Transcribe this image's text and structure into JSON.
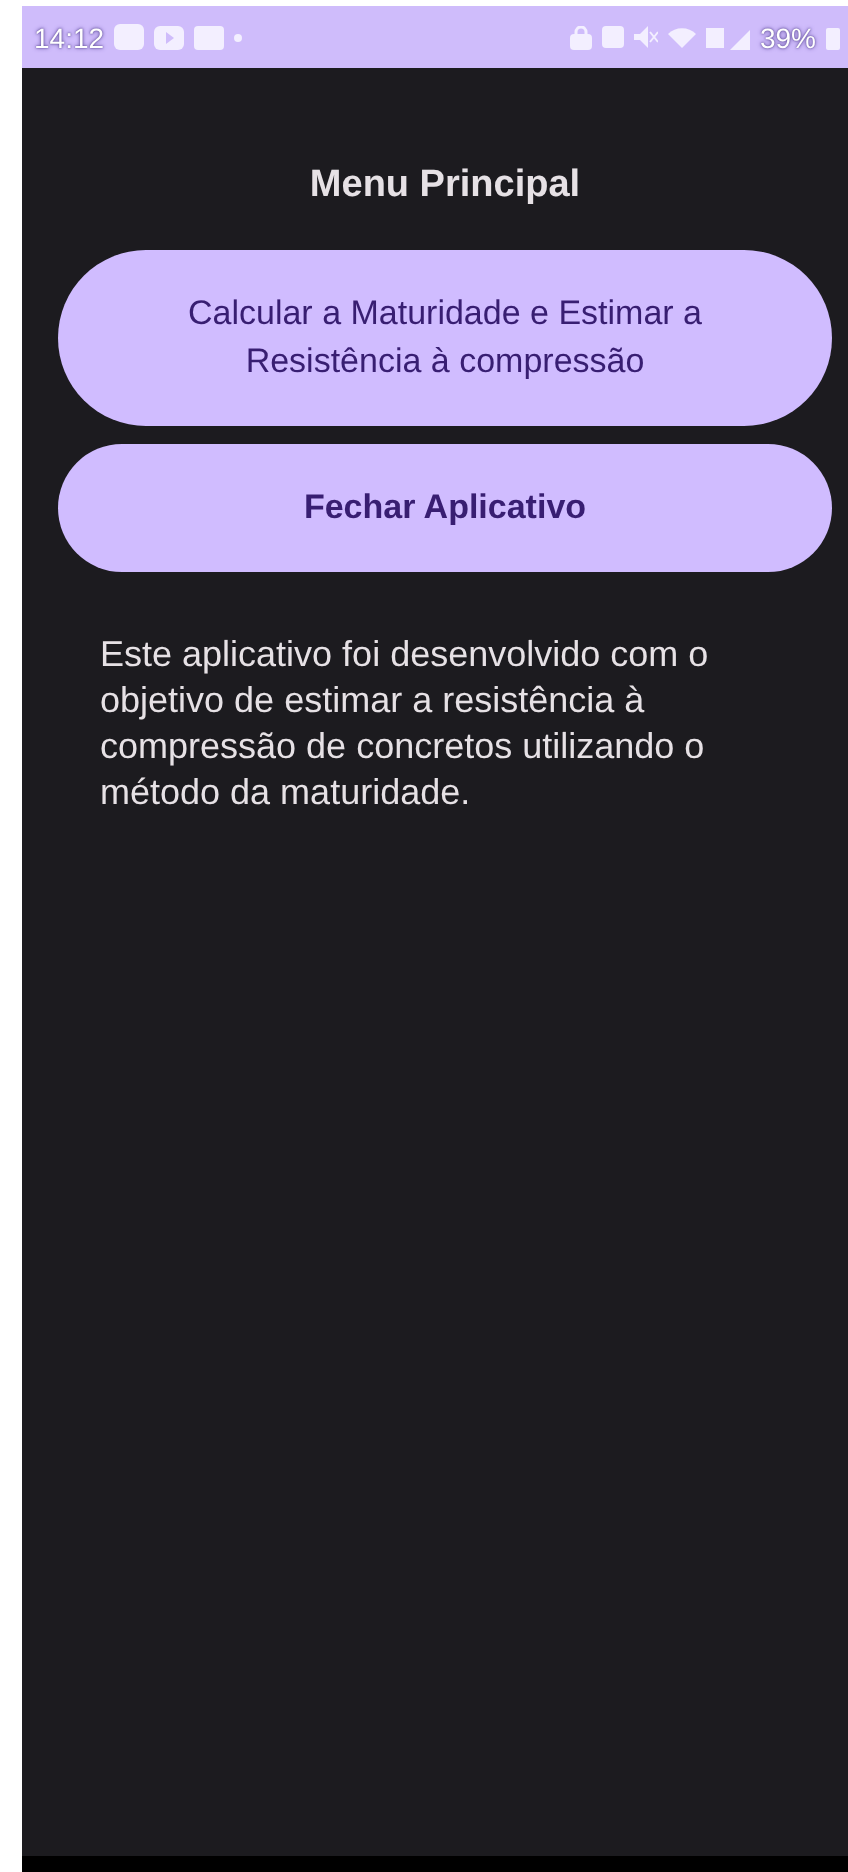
{
  "status_bar": {
    "time": "14:12",
    "battery": "39%"
  },
  "title": "Menu Principal",
  "buttons": [
    "Calcular a Maturidade e Estimar a Resistência à compressão",
    "Fechar Aplicativo"
  ],
  "description": "Este aplicativo foi desenvolvido com o objetivo de estimar a resistência à compressão de concretos utilizando o método da maturidade."
}
